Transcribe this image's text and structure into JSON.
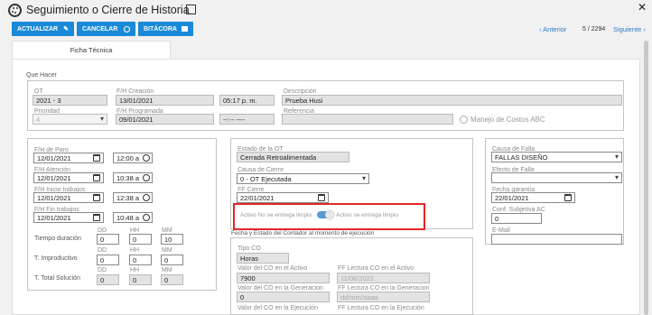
{
  "header": {
    "title": "Seguimiento o Cierre de Historia",
    "close_glyph": "✕"
  },
  "toolbar": {
    "update": "ACTUALIZAR",
    "cancel": "CANCELAR",
    "log": "BITÁCORA"
  },
  "pager": {
    "prev": "Anterior",
    "position": "5 / 2294",
    "next": "Siguiente"
  },
  "tab": "Ficha Técnica",
  "que_hacer": {
    "title": "Que Hacer",
    "ot_label": "OT",
    "ot": "2021 - 3",
    "fh_creacion_label": "F/H Creación",
    "fh_creacion": "13/01/2021",
    "hora_creacion": "05:17 p. m.",
    "descripcion_label": "Descripción",
    "descripcion": "Prueba Husi",
    "prioridad_label": "Prioridad",
    "prioridad": "4",
    "fh_programada_label": "F/H Programada",
    "fh_programada": "09/01/2021",
    "hora_programada": "--:-- ----",
    "referencia_label": "Referencia",
    "referencia": "",
    "abc_label": "Manejo de Costos ABC"
  },
  "times": {
    "paro_label": "F/H de Paro",
    "paro_date": "12/01/2021",
    "paro_time": "12:00 a",
    "atencion_label": "F/H Atención",
    "atencion_date": "12/01/2021",
    "atencion_time": "10:38 a",
    "inicio_label": "F/H Inicio trabajos",
    "inicio_date": "12/01/2021",
    "inicio_time": "12:38 a",
    "fin_label": "F/H Fin trabajos",
    "fin_date": "12/01/2021",
    "fin_time": "10:48 a",
    "dd": "DD",
    "hh": "HH",
    "mm": "MM",
    "duracion_label": "Tiempo duración",
    "duracion": [
      "0",
      "0",
      "10"
    ],
    "improductivo_label": "T. Improductivo",
    "improductivo": [
      "0",
      "0",
      "0"
    ],
    "total_label": "T. Total Solución",
    "total": [
      "0",
      "0",
      "0"
    ]
  },
  "estado": {
    "estado_label": "Estado de la OT",
    "estado": "Cerrada Retroalimentada",
    "causa_cierre_label": "Causa de Cierre",
    "causa_cierre": "0 - OT Ejecutada",
    "ff_cierre_label": "FF Cierre",
    "ff_cierre": "22/01/2021",
    "toggle_off": "Activo No se entrega limpio",
    "toggle_on": "Activo se entrega limpio",
    "toggle_color": "#5b9bd5",
    "highlight_color": "#e32626"
  },
  "falla": {
    "causa_label": "Causa de Falla",
    "causa": "FALLAS DISEÑO",
    "efecto_label": "Efecto de Falla",
    "efecto": "",
    "garantia_label": "Fecha garantía",
    "garantia": "22/01/2021",
    "conf_label": "Conf. Subjetiva AC",
    "conf": "0",
    "email_label": "E-Mail",
    "email": ""
  },
  "contador": {
    "title": "Fecha y Estado del Contador al momento de ejecución",
    "tipo_label": "Tipo CO",
    "tipo": "Horas",
    "activo_label": "Valor del CO en el Activo",
    "activo": "7900",
    "ff_activo_label": "FF Lectura CO en el Activo",
    "ff_activo": "11/08/2022",
    "gen_label": "Valor del CO en la Generacion",
    "gen": "0",
    "ff_gen_label": "FF Lectura CO en la Generacion",
    "ff_gen": "dd/mm/aaaa",
    "ejec_label": "Valor del CO en la Ejecución",
    "ff_ejec_label": "FF Lectura CO en la Ejecución"
  }
}
